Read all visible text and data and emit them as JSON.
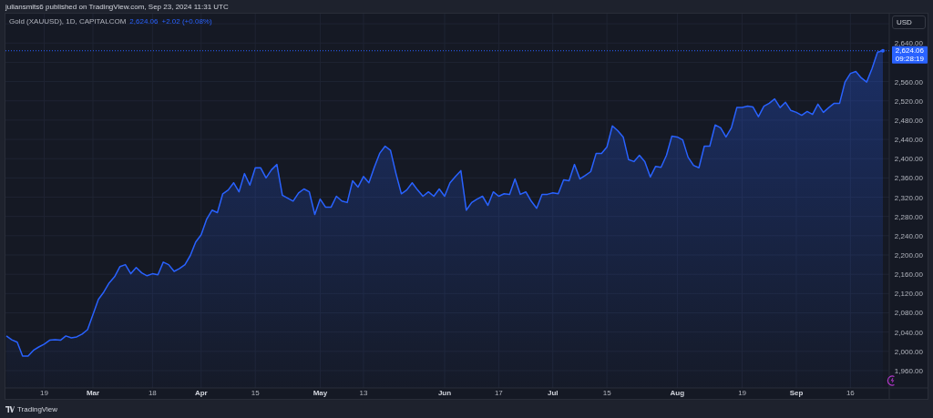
{
  "header": {
    "text": "juliansmits6 published on TradingView.com, Sep 23, 2024 11:31 UTC"
  },
  "legend": {
    "symbol": "Gold (XAUUSD), 1D, CAPITALCOM",
    "price": "2,624.06",
    "change": "+2.02 (+0.08%)"
  },
  "currency_button": "USD",
  "price_tag": {
    "price": "2,624.06",
    "countdown": "09:28:19"
  },
  "chart_data": {
    "type": "area",
    "ylim": [
      1924,
      2701
    ],
    "grid": true,
    "categories": [
      null,
      null,
      null,
      null,
      null,
      null,
      null,
      "19",
      null,
      null,
      null,
      null,
      null,
      null,
      null,
      null,
      "Mar",
      null,
      null,
      null,
      null,
      null,
      null,
      null,
      null,
      null,
      null,
      "18",
      null,
      null,
      null,
      null,
      null,
      null,
      null,
      null,
      "Apr",
      null,
      null,
      null,
      null,
      null,
      null,
      null,
      null,
      null,
      "15",
      null,
      null,
      null,
      null,
      null,
      null,
      null,
      null,
      null,
      null,
      null,
      "May",
      null,
      null,
      null,
      null,
      null,
      null,
      null,
      "13",
      null,
      null,
      null,
      null,
      null,
      null,
      null,
      null,
      null,
      null,
      null,
      null,
      null,
      null,
      "Jun",
      null,
      null,
      null,
      null,
      null,
      null,
      null,
      null,
      null,
      "17",
      null,
      null,
      null,
      null,
      null,
      null,
      null,
      null,
      null,
      "Jul",
      null,
      null,
      null,
      null,
      null,
      null,
      null,
      null,
      null,
      "15",
      null,
      null,
      null,
      null,
      null,
      null,
      null,
      null,
      null,
      null,
      null,
      null,
      "Aug",
      null,
      null,
      null,
      null,
      null,
      null,
      null,
      null,
      null,
      null,
      null,
      "19",
      null,
      null,
      null,
      null,
      null,
      null,
      null,
      null,
      null,
      "Sep",
      null,
      null,
      null,
      null,
      null,
      null,
      null,
      null,
      null,
      "16",
      null,
      null,
      null,
      null,
      null,
      null
    ],
    "ref_lines": [
      {
        "axis": "y",
        "value": 2624,
        "color": "#2962ff"
      }
    ],
    "series": [
      {
        "color": "#2962ff",
        "values": [
          2032,
          2024,
          2019,
          1990,
          1990,
          2002,
          2009,
          2015,
          2023,
          2024,
          2023,
          2032,
          2028,
          2030,
          2036,
          2045,
          2076,
          2108,
          2123,
          2142,
          2155,
          2176,
          2180,
          2161,
          2174,
          2163,
          2157,
          2161,
          2159,
          2185,
          2180,
          2166,
          2172,
          2180,
          2199,
          2227,
          2242,
          2274,
          2293,
          2288,
          2327,
          2335,
          2350,
          2331,
          2369,
          2345,
          2381,
          2381,
          2360,
          2377,
          2388,
          2324,
          2318,
          2312,
          2329,
          2337,
          2331,
          2284,
          2316,
          2299,
          2299,
          2322,
          2312,
          2309,
          2354,
          2341,
          2363,
          2350,
          2382,
          2411,
          2426,
          2417,
          2369,
          2327,
          2335,
          2350,
          2335,
          2322,
          2331,
          2322,
          2337,
          2322,
          2350,
          2363,
          2375,
          2293,
          2309,
          2316,
          2322,
          2303,
          2331,
          2322,
          2327,
          2326,
          2358,
          2326,
          2331,
          2312,
          2297,
          2326,
          2326,
          2329,
          2327,
          2356,
          2354,
          2388,
          2358,
          2365,
          2373,
          2411,
          2411,
          2424,
          2468,
          2458,
          2445,
          2398,
          2394,
          2407,
          2394,
          2362,
          2384,
          2382,
          2407,
          2447,
          2445,
          2439,
          2403,
          2386,
          2381,
          2426,
          2426,
          2470,
          2464,
          2445,
          2464,
          2506,
          2506,
          2509,
          2507,
          2487,
          2509,
          2515,
          2524,
          2506,
          2517,
          2500,
          2496,
          2490,
          2498,
          2492,
          2513,
          2496,
          2506,
          2515,
          2515,
          2559,
          2577,
          2581,
          2568,
          2559,
          2587,
          2621,
          2624
        ]
      }
    ],
    "yticks": [
      {
        "value": 2640,
        "label": "2,640.00"
      },
      {
        "value": 2560,
        "label": "2,560.00"
      },
      {
        "value": 2520,
        "label": "2,520.00"
      },
      {
        "value": 2480,
        "label": "2,480.00"
      },
      {
        "value": 2440,
        "label": "2,440.00"
      },
      {
        "value": 2400,
        "label": "2,400.00"
      },
      {
        "value": 2360,
        "label": "2,360.00"
      },
      {
        "value": 2320,
        "label": "2,320.00"
      },
      {
        "value": 2280,
        "label": "2,280.00"
      },
      {
        "value": 2240,
        "label": "2,240.00"
      },
      {
        "value": 2200,
        "label": "2,200.00"
      },
      {
        "value": 2160,
        "label": "2,160.00"
      },
      {
        "value": 2120,
        "label": "2,120.00"
      },
      {
        "value": 2080,
        "label": "2,080.00"
      },
      {
        "value": 2040,
        "label": "2,040.00"
      },
      {
        "value": 2000,
        "label": "2,000.00"
      },
      {
        "value": 1960,
        "label": "1,960.00"
      }
    ]
  },
  "footer": {
    "brand": "TradingView"
  }
}
